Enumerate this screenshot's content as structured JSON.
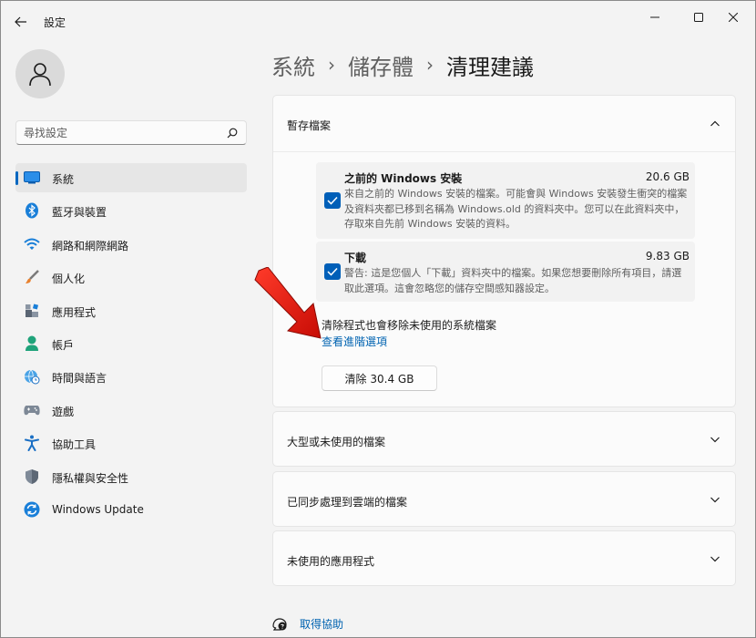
{
  "window": {
    "title": "設定"
  },
  "sidebar": {
    "search_placeholder": "尋找設定",
    "items": [
      {
        "label": "系統",
        "icon": "monitor-icon",
        "selected": true
      },
      {
        "label": "藍牙與裝置",
        "icon": "bluetooth-icon"
      },
      {
        "label": "網路和網際網路",
        "icon": "wifi-icon"
      },
      {
        "label": "個人化",
        "icon": "brush-icon"
      },
      {
        "label": "應用程式",
        "icon": "apps-icon"
      },
      {
        "label": "帳戶",
        "icon": "person-icon"
      },
      {
        "label": "時間與語言",
        "icon": "globe-clock-icon"
      },
      {
        "label": "遊戲",
        "icon": "gamepad-icon"
      },
      {
        "label": "協助工具",
        "icon": "accessibility-icon"
      },
      {
        "label": "隱私權與安全性",
        "icon": "shield-icon"
      },
      {
        "label": "Windows Update",
        "icon": "update-icon"
      }
    ]
  },
  "breadcrumb": {
    "level1": "系統",
    "level2": "儲存體",
    "level3": "清理建議",
    "separator": "›"
  },
  "temp_files": {
    "title": "暫存檔案",
    "items": [
      {
        "name": "之前的 Windows 安裝",
        "size": "20.6 GB",
        "checked": true,
        "description": "來自之前的 Windows 安裝的檔案。可能會與 Windows 安裝發生衝突的檔案及資料夾都已移到名稱為 Windows.old 的資料夾中。您可以在此資料夾中，存取來自先前 Windows 安裝的資料。"
      },
      {
        "name": "下載",
        "size": "9.83 GB",
        "checked": true,
        "description": "警告: 這是您個人「下載」資料夾中的檔案。如果您想要刪除所有項目，請選取此選項。這會忽略您的儲存空間感知器設定。"
      }
    ],
    "note": "清除程式也會移除未使用的系統檔案",
    "advanced_link": "查看進階選項",
    "clean_button": "清除 30.4 GB"
  },
  "sections": [
    {
      "title": "大型或未使用的檔案"
    },
    {
      "title": "已同步處理到雲端的檔案"
    },
    {
      "title": "未使用的應用程式"
    }
  ],
  "help": {
    "label": "取得協助"
  },
  "colors": {
    "accent": "#005fb8",
    "link": "#0063b1",
    "annotation_arrow": "#e8140c"
  }
}
